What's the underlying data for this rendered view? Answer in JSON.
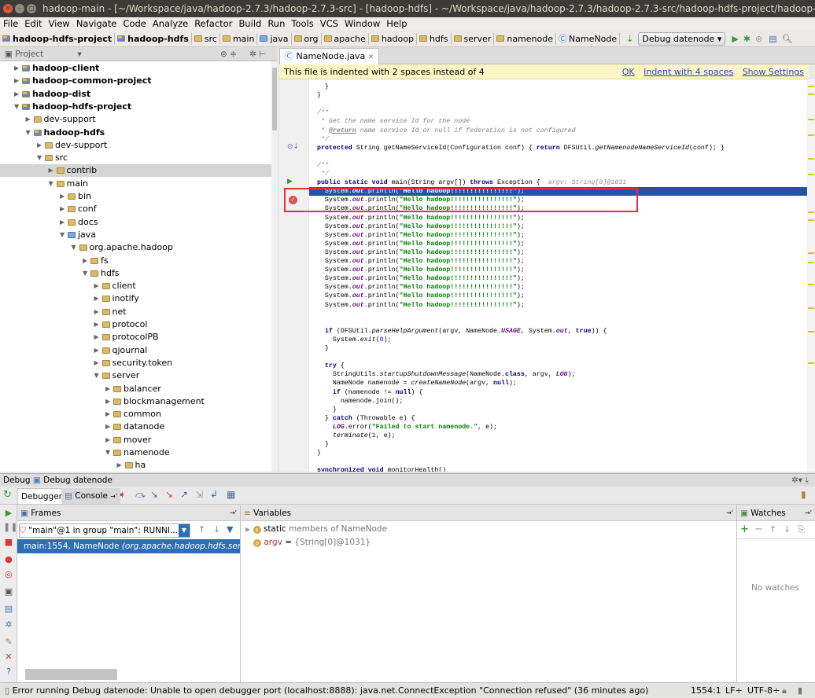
{
  "window": {
    "title": "hadoop-main - [~/Workspace/java/hadoop-2.7.3/hadoop-2.7.3-src] - [hadoop-hdfs] - ~/Workspace/java/hadoop-2.7.3/hadoop-2.7.3-src/hadoop-hdfs-project/hadoop-hdfs/src/main/java/"
  },
  "menu": [
    "File",
    "Edit",
    "View",
    "Navigate",
    "Code",
    "Analyze",
    "Refactor",
    "Build",
    "Run",
    "Tools",
    "VCS",
    "Window",
    "Help"
  ],
  "breadcrumbs": [
    {
      "label": "hadoop-hdfs-project",
      "bold": true,
      "icon": "module-folder"
    },
    {
      "label": "hadoop-hdfs",
      "bold": true,
      "icon": "module-folder"
    },
    {
      "label": "src",
      "icon": "folder"
    },
    {
      "label": "main",
      "icon": "folder"
    },
    {
      "label": "java",
      "icon": "source-folder"
    },
    {
      "label": "org",
      "icon": "package"
    },
    {
      "label": "apache",
      "icon": "package"
    },
    {
      "label": "hadoop",
      "icon": "package"
    },
    {
      "label": "hdfs",
      "icon": "package"
    },
    {
      "label": "server",
      "icon": "package"
    },
    {
      "label": "namenode",
      "icon": "package"
    },
    {
      "label": "NameNode",
      "icon": "class"
    }
  ],
  "run_config": "Debug datenode",
  "project_panel": {
    "title": "Project"
  },
  "tree": [
    {
      "label": "hadoop-client",
      "level": 0,
      "bold": true,
      "expanded": false
    },
    {
      "label": "hadoop-common-project",
      "level": 0,
      "bold": true,
      "expanded": false
    },
    {
      "label": "hadoop-dist",
      "level": 0,
      "bold": true,
      "expanded": false
    },
    {
      "label": "hadoop-hdfs-project",
      "level": 0,
      "bold": true,
      "expanded": true
    },
    {
      "label": "dev-support",
      "level": 1,
      "expanded": false
    },
    {
      "label": "hadoop-hdfs",
      "level": 1,
      "bold": true,
      "expanded": true
    },
    {
      "label": "dev-support",
      "level": 2,
      "expanded": false
    },
    {
      "label": "src",
      "level": 2,
      "expanded": true
    },
    {
      "label": "contrib",
      "level": 3,
      "expanded": false,
      "selected": true
    },
    {
      "label": "main",
      "level": 3,
      "expanded": true
    },
    {
      "label": "bin",
      "level": 4,
      "expanded": false
    },
    {
      "label": "conf",
      "level": 4,
      "expanded": false
    },
    {
      "label": "docs",
      "level": 4,
      "expanded": false
    },
    {
      "label": "java",
      "level": 4,
      "expanded": true,
      "source": true
    },
    {
      "label": "org.apache.hadoop",
      "level": 5,
      "expanded": true
    },
    {
      "label": "fs",
      "level": 6,
      "expanded": false
    },
    {
      "label": "hdfs",
      "level": 6,
      "expanded": true
    },
    {
      "label": "client",
      "level": 7,
      "expanded": false
    },
    {
      "label": "inotify",
      "level": 7,
      "expanded": false
    },
    {
      "label": "net",
      "level": 7,
      "expanded": false
    },
    {
      "label": "protocol",
      "level": 7,
      "expanded": false
    },
    {
      "label": "protocolPB",
      "level": 7,
      "expanded": false
    },
    {
      "label": "qjournal",
      "level": 7,
      "expanded": false
    },
    {
      "label": "security.token",
      "level": 7,
      "expanded": false
    },
    {
      "label": "server",
      "level": 7,
      "expanded": true
    },
    {
      "label": "balancer",
      "level": 8,
      "expanded": false
    },
    {
      "label": "blockmanagement",
      "level": 8,
      "expanded": false
    },
    {
      "label": "common",
      "level": 8,
      "expanded": false
    },
    {
      "label": "datanode",
      "level": 8,
      "expanded": false
    },
    {
      "label": "mover",
      "level": 8,
      "expanded": false
    },
    {
      "label": "namenode",
      "level": 8,
      "expanded": true
    },
    {
      "label": "ha",
      "level": 9,
      "expanded": false
    }
  ],
  "editor": {
    "tab": "NameNode.java",
    "banner": {
      "text": "This file is indented with 2 spaces instead of 4",
      "ok": "OK",
      "indent": "Indent with 4 spaces",
      "settings": "Show Settings"
    },
    "highlight_line": 12,
    "lines": [
      [
        [
          "    }"
        ]
      ],
      [
        [
          "  }"
        ]
      ],
      [],
      [
        [
          "  /**",
          "c"
        ]
      ],
      [
        [
          "   * Get the name service Id for the node",
          "c"
        ]
      ],
      [
        [
          "   * ",
          "c"
        ],
        [
          "@return",
          "cd"
        ],
        [
          " name service Id or null if federation is not configured",
          "c"
        ]
      ],
      [
        [
          "   */",
          "c"
        ]
      ],
      [
        [
          "  "
        ],
        [
          "protected",
          "k"
        ],
        [
          " String getNameServiceId(Configuration conf) { "
        ],
        [
          "return",
          "k"
        ],
        [
          " DFSUtil."
        ],
        [
          "getNamenodeNameServiceId",
          "i"
        ],
        [
          "(conf); }"
        ]
      ],
      [],
      [
        [
          "  /**",
          "c"
        ]
      ],
      [
        [
          "   */",
          "c"
        ]
      ],
      [
        [
          "  "
        ],
        [
          "public static void",
          "k"
        ],
        [
          " main(String argv[]) "
        ],
        [
          "throws",
          "k"
        ],
        [
          " Exception {  "
        ],
        [
          "argv: String[0]@1031",
          "h"
        ]
      ],
      [
        [
          "    System."
        ],
        [
          "out",
          "f"
        ],
        [
          ".println("
        ],
        [
          "\"Hello hadoop!!!!!!!!!!!!!!!!\"",
          "s"
        ],
        [
          ");"
        ]
      ],
      [
        [
          "    System."
        ],
        [
          "out",
          "f"
        ],
        [
          ".println("
        ],
        [
          "\"Hello hadoop!!!!!!!!!!!!!!!!\"",
          "s"
        ],
        [
          ");"
        ]
      ],
      [
        [
          "    System."
        ],
        [
          "out",
          "f"
        ],
        [
          ".println("
        ],
        [
          "\"Hello hadoop!!!!!!!!!!!!!!!!\"",
          "s"
        ],
        [
          ");"
        ]
      ],
      [
        [
          "    System."
        ],
        [
          "out",
          "f"
        ],
        [
          ".println("
        ],
        [
          "\"Hello hadoop!!!!!!!!!!!!!!!!\"",
          "s"
        ],
        [
          ");"
        ]
      ],
      [
        [
          "    System."
        ],
        [
          "out",
          "f"
        ],
        [
          ".println("
        ],
        [
          "\"Hello hadoop!!!!!!!!!!!!!!!!\"",
          "s"
        ],
        [
          ");"
        ]
      ],
      [
        [
          "    System."
        ],
        [
          "out",
          "f"
        ],
        [
          ".println("
        ],
        [
          "\"Hello hadoop!!!!!!!!!!!!!!!!\"",
          "s"
        ],
        [
          ");"
        ]
      ],
      [
        [
          "    System."
        ],
        [
          "out",
          "f"
        ],
        [
          ".println("
        ],
        [
          "\"Hello hadoop!!!!!!!!!!!!!!!!\"",
          "s"
        ],
        [
          ");"
        ]
      ],
      [
        [
          "    System."
        ],
        [
          "out",
          "f"
        ],
        [
          ".println("
        ],
        [
          "\"Hello hadoop!!!!!!!!!!!!!!!!\"",
          "s"
        ],
        [
          ");"
        ]
      ],
      [
        [
          "    System."
        ],
        [
          "out",
          "f"
        ],
        [
          ".println("
        ],
        [
          "\"Hello hadoop!!!!!!!!!!!!!!!!\"",
          "s"
        ],
        [
          ");"
        ]
      ],
      [
        [
          "    System."
        ],
        [
          "out",
          "f"
        ],
        [
          ".println("
        ],
        [
          "\"Hello hadoop!!!!!!!!!!!!!!!!\"",
          "s"
        ],
        [
          ");"
        ]
      ],
      [
        [
          "    System."
        ],
        [
          "out",
          "f"
        ],
        [
          ".println("
        ],
        [
          "\"Hello hadoop!!!!!!!!!!!!!!!!\"",
          "s"
        ],
        [
          ");"
        ]
      ],
      [
        [
          "    System."
        ],
        [
          "out",
          "f"
        ],
        [
          ".println("
        ],
        [
          "\"Hello hadoop!!!!!!!!!!!!!!!!\"",
          "s"
        ],
        [
          ");"
        ]
      ],
      [
        [
          "    System."
        ],
        [
          "out",
          "f"
        ],
        [
          ".println("
        ],
        [
          "\"Hello hadoop!!!!!!!!!!!!!!!!\"",
          "s"
        ],
        [
          ");"
        ]
      ],
      [
        [
          "    System."
        ],
        [
          "out",
          "f"
        ],
        [
          ".println("
        ],
        [
          "\"Hello hadoop!!!!!!!!!!!!!!!!\"",
          "s"
        ],
        [
          ");"
        ]
      ],
      [],
      [],
      [
        [
          "    "
        ],
        [
          "if",
          "k"
        ],
        [
          " (DFSUtil."
        ],
        [
          "parseHelpArgument",
          "i"
        ],
        [
          "(argv, NameNode."
        ],
        [
          "USAGE",
          "f"
        ],
        [
          ", System."
        ],
        [
          "out",
          "f"
        ],
        [
          ", "
        ],
        [
          "true",
          "k"
        ],
        [
          ")) {"
        ]
      ],
      [
        [
          "      System."
        ],
        [
          "exit",
          "i"
        ],
        [
          "("
        ],
        [
          "0",
          "n"
        ],
        [
          ");"
        ]
      ],
      [
        [
          "    }"
        ]
      ],
      [],
      [
        [
          "    "
        ],
        [
          "try",
          "k"
        ],
        [
          " {"
        ]
      ],
      [
        [
          "      StringUtils."
        ],
        [
          "startupShutdownMessage",
          "i"
        ],
        [
          "(NameNode."
        ],
        [
          "class",
          "k"
        ],
        [
          ", argv, "
        ],
        [
          "LOG",
          "f"
        ],
        [
          ");"
        ]
      ],
      [
        [
          "      NameNode namenode = "
        ],
        [
          "createNameNode",
          "i"
        ],
        [
          "(argv, "
        ],
        [
          "null",
          "k"
        ],
        [
          ");"
        ]
      ],
      [
        [
          "      "
        ],
        [
          "if",
          "k"
        ],
        [
          " (namenode != "
        ],
        [
          "null",
          "k"
        ],
        [
          ") {"
        ]
      ],
      [
        [
          "        namenode.join();"
        ]
      ],
      [
        [
          "      }"
        ]
      ],
      [
        [
          "    } "
        ],
        [
          "catch",
          "k"
        ],
        [
          " (Throwable e) {"
        ]
      ],
      [
        [
          "      "
        ],
        [
          "LOG",
          "f"
        ],
        [
          ".error("
        ],
        [
          "\"Failed to start namenode.\"",
          "s"
        ],
        [
          ", e);"
        ]
      ],
      [
        [
          "      "
        ],
        [
          "terminate",
          "i"
        ],
        [
          "("
        ],
        [
          "1",
          "n"
        ],
        [
          ", e);"
        ]
      ],
      [
        [
          "    }"
        ]
      ],
      [
        [
          "  }"
        ]
      ],
      [],
      [
        [
          "  "
        ],
        [
          "synchronized void",
          "k"
        ],
        [
          " monitorHealth()"
        ]
      ]
    ]
  },
  "debug": {
    "title": "Debug",
    "config": "Debug datenode",
    "tabs": [
      "Debugger",
      "Console"
    ],
    "frames": {
      "title": "Frames",
      "thread": "\"main\"@1 in group \"main\": RUNNI...",
      "frame_method": "main:1554, NameNode",
      "frame_class": "(org.apache.hadoop.hdfs.server."
    },
    "variables": {
      "title": "Variables",
      "items": [
        {
          "kw": "static",
          "text": "members of NameNode",
          "badge": "s"
        },
        {
          "name": "argv",
          "eq": " = ",
          "value": "{String[0]@1031}",
          "badge": "p"
        }
      ]
    },
    "watches": {
      "title": "Watches",
      "empty": "No watches"
    }
  },
  "status": {
    "message": "Error running Debug datenode: Unable to open debugger port (localhost:8888): java.net.ConnectException \"Connection refused\" (36 minutes ago)",
    "position": "1554:1",
    "line_sep": "LF÷",
    "encoding": "UTF-8÷"
  },
  "colors": {
    "accent": "#2154a6",
    "breakpoint": "#d9534f",
    "banner": "#fbf6c3",
    "highlight_box": "#e8303a"
  }
}
